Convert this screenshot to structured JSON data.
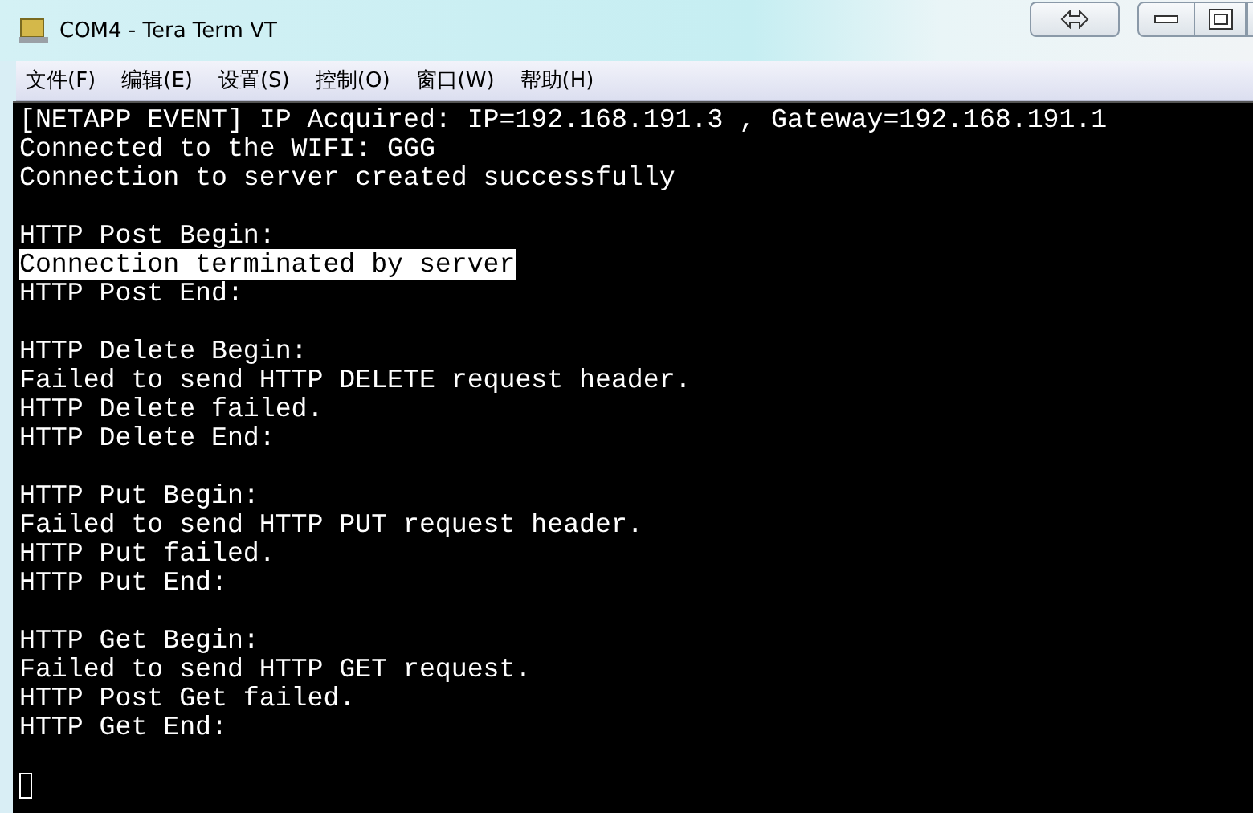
{
  "window": {
    "title": "COM4 - Tera Term VT"
  },
  "menu": [
    "文件(F)",
    "编辑(E)",
    "设置(S)",
    "控制(O)",
    "窗口(W)",
    "帮助(H)"
  ],
  "terminal": {
    "blocks": [
      {
        "lines": [
          {
            "text": "[NETAPP EVENT] IP Acquired: IP=192.168.191.3 , Gateway=192.168.191.1",
            "highlighted": false
          },
          {
            "text": "Connected to the WIFI: GGG",
            "highlighted": false
          },
          {
            "text": "Connection to server created successfully",
            "highlighted": false
          }
        ]
      },
      {
        "lines": [
          {
            "text": "HTTP Post Begin:",
            "highlighted": false
          },
          {
            "text": "Connection terminated by server",
            "highlighted": true
          },
          {
            "text": "HTTP Post End:",
            "highlighted": false
          }
        ]
      },
      {
        "lines": [
          {
            "text": "HTTP Delete Begin:",
            "highlighted": false
          },
          {
            "text": "Failed to send HTTP DELETE request header.",
            "highlighted": false
          },
          {
            "text": "HTTP Delete failed.",
            "highlighted": false
          },
          {
            "text": "HTTP Delete End:",
            "highlighted": false
          }
        ]
      },
      {
        "lines": [
          {
            "text": "HTTP Put Begin:",
            "highlighted": false
          },
          {
            "text": "Failed to send HTTP PUT request header.",
            "highlighted": false
          },
          {
            "text": "HTTP Put failed.",
            "highlighted": false
          },
          {
            "text": "HTTP Put End:",
            "highlighted": false
          }
        ]
      },
      {
        "lines": [
          {
            "text": "HTTP Get Begin:",
            "highlighted": false
          },
          {
            "text": "Failed to send HTTP GET request.",
            "highlighted": false
          },
          {
            "text": "HTTP Post Get failed.",
            "highlighted": false
          },
          {
            "text": "HTTP Get End:",
            "highlighted": false
          }
        ]
      }
    ]
  }
}
